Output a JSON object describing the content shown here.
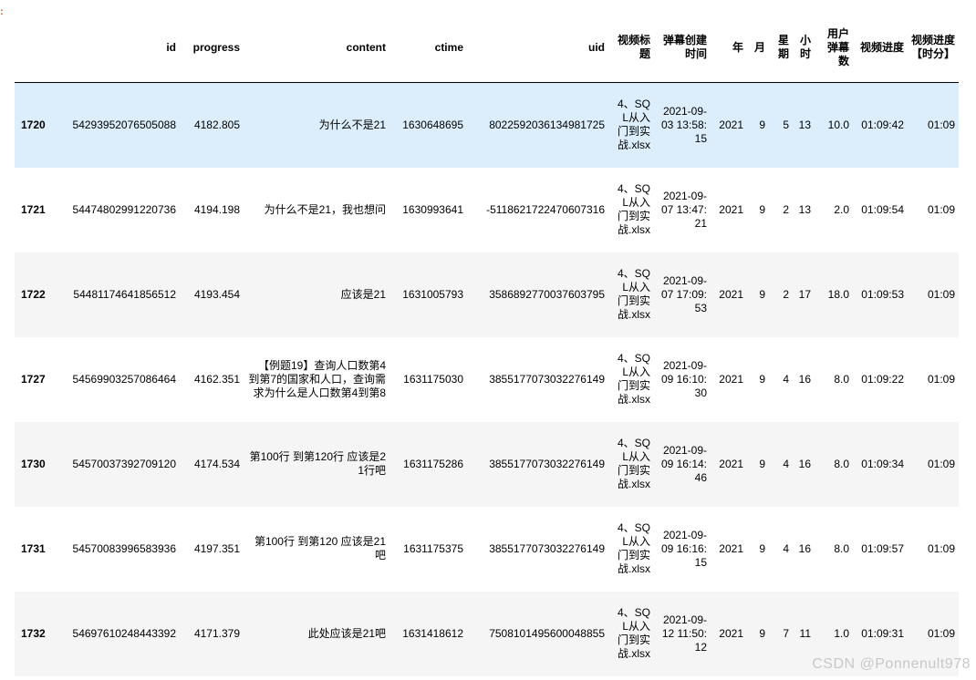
{
  "side_marker": ":",
  "table": {
    "columns": [
      "",
      "id",
      "progress",
      "content",
      "ctime",
      "uid",
      "视频标题",
      "弹幕创建时间",
      "年",
      "月",
      "星期",
      "小时",
      "用户弹幕数",
      "视频进度",
      "视频进度【时分】"
    ],
    "rows": [
      {
        "index": "1720",
        "id": "54293952076505088",
        "progress": "4182.805",
        "content": "为什么不是21",
        "ctime": "1630648695",
        "uid": "8022592036134981725",
        "title": "4、SQL从入门到实战.xlsx",
        "created": "2021-09-03 13:58:15",
        "year": "2021",
        "month": "9",
        "weekday": "5",
        "hour": "13",
        "user_count": "10.0",
        "video_progress": "01:09:42",
        "progress_hm": "01:09"
      },
      {
        "index": "1721",
        "id": "54474802991220736",
        "progress": "4194.198",
        "content": "为什么不是21，我也想问",
        "ctime": "1630993641",
        "uid": "-5118621722470607316",
        "title": "4、SQL从入门到实战.xlsx",
        "created": "2021-09-07 13:47:21",
        "year": "2021",
        "month": "9",
        "weekday": "2",
        "hour": "13",
        "user_count": "2.0",
        "video_progress": "01:09:54",
        "progress_hm": "01:09"
      },
      {
        "index": "1722",
        "id": "54481174641856512",
        "progress": "4193.454",
        "content": "应该是21",
        "ctime": "1631005793",
        "uid": "3586892770037603795",
        "title": "4、SQL从入门到实战.xlsx",
        "created": "2021-09-07 17:09:53",
        "year": "2021",
        "month": "9",
        "weekday": "2",
        "hour": "17",
        "user_count": "18.0",
        "video_progress": "01:09:53",
        "progress_hm": "01:09"
      },
      {
        "index": "1727",
        "id": "54569903257086464",
        "progress": "4162.351",
        "content": "【例题19】查询人口数第4到第7的国家和人口，查询需求为什么是人口数第4到第8",
        "ctime": "1631175030",
        "uid": "3855177073032276149",
        "title": "4、SQL从入门到实战.xlsx",
        "created": "2021-09-09 16:10:30",
        "year": "2021",
        "month": "9",
        "weekday": "4",
        "hour": "16",
        "user_count": "8.0",
        "video_progress": "01:09:22",
        "progress_hm": "01:09"
      },
      {
        "index": "1730",
        "id": "54570037392709120",
        "progress": "4174.534",
        "content": "第100行 到第120行 应该是21行吧",
        "ctime": "1631175286",
        "uid": "3855177073032276149",
        "title": "4、SQL从入门到实战.xlsx",
        "created": "2021-09-09 16:14:46",
        "year": "2021",
        "month": "9",
        "weekday": "4",
        "hour": "16",
        "user_count": "8.0",
        "video_progress": "01:09:34",
        "progress_hm": "01:09"
      },
      {
        "index": "1731",
        "id": "54570083996583936",
        "progress": "4197.351",
        "content": "第100行 到第120 应该是21吧",
        "ctime": "1631175375",
        "uid": "3855177073032276149",
        "title": "4、SQL从入门到实战.xlsx",
        "created": "2021-09-09 16:16:15",
        "year": "2021",
        "month": "9",
        "weekday": "4",
        "hour": "16",
        "user_count": "8.0",
        "video_progress": "01:09:57",
        "progress_hm": "01:09"
      },
      {
        "index": "1732",
        "id": "54697610248443392",
        "progress": "4171.379",
        "content": "此处应该是21吧",
        "ctime": "1631418612",
        "uid": "7508101495600048855",
        "title": "4、SQL从入门到实战.xlsx",
        "created": "2021-09-12 11:50:12",
        "year": "2021",
        "month": "9",
        "weekday": "7",
        "hour": "11",
        "user_count": "1.0",
        "video_progress": "01:09:31",
        "progress_hm": "01:09"
      }
    ]
  },
  "watermark": "CSDN @Ponnenult978"
}
